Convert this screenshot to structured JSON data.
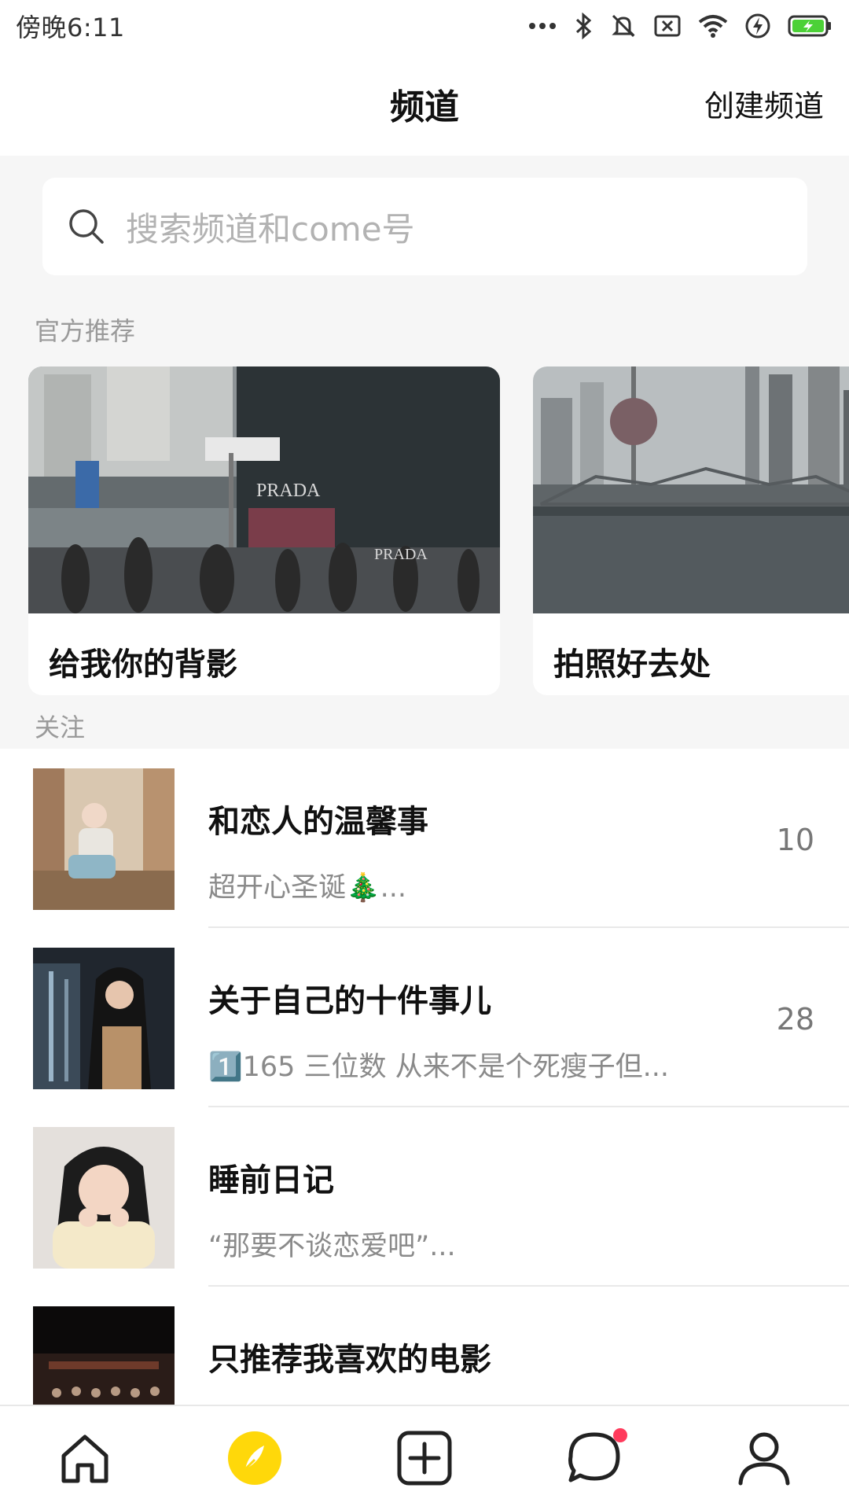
{
  "status_bar": {
    "time": "傍晚6:11",
    "icons": [
      "more-dots-icon",
      "bluetooth-icon",
      "mute-bell-icon",
      "no-sim-icon",
      "wifi-icon",
      "charging-icon",
      "battery-icon"
    ],
    "battery_color": "#4cd137"
  },
  "header": {
    "title": "频道",
    "create_label": "创建频道"
  },
  "search": {
    "placeholder": "搜索频道和come号"
  },
  "sections": {
    "official_label": "官方推荐",
    "follow_label": "关注"
  },
  "recommendations": [
    {
      "title": "给我你的背影",
      "image": "street-photo"
    },
    {
      "title": "拍照好去处",
      "image": "city-skyline-photo"
    }
  ],
  "follow_list": [
    {
      "title": "和恋人的温馨事",
      "subtitle": "超开心圣诞🎄...",
      "count": "10",
      "image": "avatar-photo"
    },
    {
      "title": "关于自己的十件事儿",
      "subtitle": "1️⃣165 三位数 从来不是个死瘦子但...",
      "count": "28",
      "image": "avatar-photo"
    },
    {
      "title": "睡前日记",
      "subtitle": "“那要不谈恋爱吧”...",
      "count": "",
      "image": "avatar-photo"
    },
    {
      "title": "只推荐我喜欢的电影",
      "subtitle": "",
      "count": "",
      "image": "movie-photo"
    }
  ],
  "bottom_nav": {
    "items": [
      "home-icon",
      "discover-icon",
      "add-post-icon",
      "messages-icon",
      "profile-icon"
    ],
    "active_color": "#ffd80a",
    "badge_color": "#ff3b5c"
  }
}
